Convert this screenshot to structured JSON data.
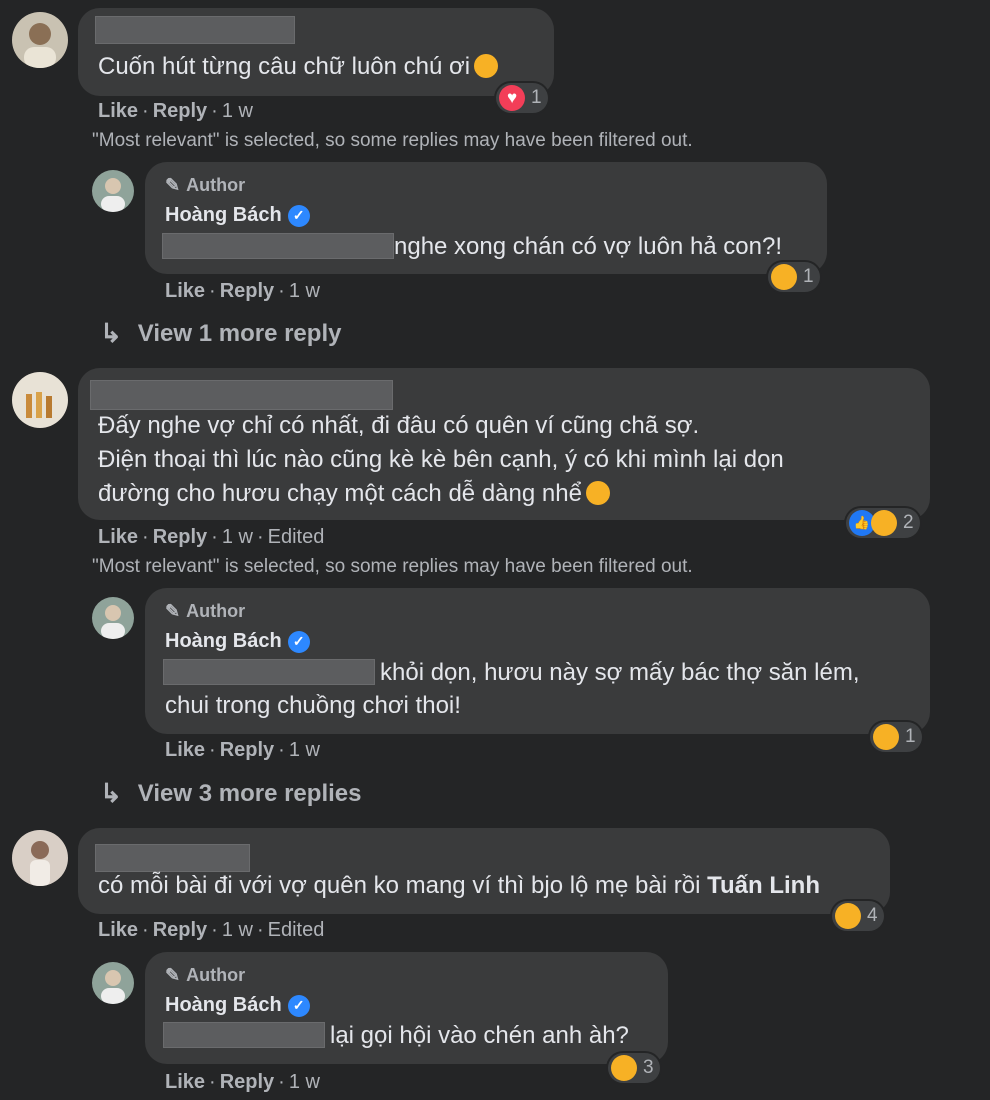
{
  "thread": {
    "comment1": {
      "text": "Cuốn hút từng câu chữ luôn chú ơi",
      "reaction_count": "1",
      "actions": {
        "like": "Like",
        "reply": "Reply",
        "time": "1 w"
      },
      "filter_note": "\"Most relevant\" is selected, so some replies may have been filtered out.",
      "reply": {
        "author_tag": "Author",
        "author_name": "Hoàng Bách",
        "text": "nghe xong chán có vợ luôn hả con?!",
        "reaction_count": "1",
        "actions": {
          "like": "Like",
          "reply": "Reply",
          "time": "1 w"
        }
      },
      "view_more": "View 1 more reply"
    },
    "comment2": {
      "line1": "Đấy nghe vợ chỉ có nhất, đi đâu có quên ví cũng chã sợ.",
      "line2": "Điện thoại thì lúc nào cũng kè kè bên cạnh, ý có khi mình lại dọn",
      "line3": "đường cho hươu chạy một cách dễ dàng nhể",
      "reaction_count": "2",
      "actions": {
        "like": "Like",
        "reply": "Reply",
        "time": "1 w",
        "edited": "Edited"
      },
      "filter_note": "\"Most relevant\" is selected, so some replies may have been filtered out.",
      "reply": {
        "author_tag": "Author",
        "author_name": "Hoàng Bách",
        "line1": "khỏi dọn, hươu này sợ mấy bác thợ săn lém,",
        "line2": "chui trong chuồng chơi thoi!",
        "reaction_count": "1",
        "actions": {
          "like": "Like",
          "reply": "Reply",
          "time": "1 w"
        }
      },
      "view_more": "View 3 more replies"
    },
    "comment3": {
      "text": "có mỗi bài đi với vợ quên ko mang ví thì bjo lộ mẹ bài rồi",
      "mention": "Tuấn Linh",
      "reaction_count": "4",
      "actions": {
        "like": "Like",
        "reply": "Reply",
        "time": "1 w",
        "edited": "Edited"
      },
      "reply": {
        "author_tag": "Author",
        "author_name": "Hoàng Bách",
        "text": "lại gọi hội vào chén anh àh?",
        "reaction_count": "3",
        "actions": {
          "like": "Like",
          "reply": "Reply",
          "time": "1 w"
        }
      }
    }
  },
  "icons": {
    "reply_arrow": "↳",
    "pencil": "✎",
    "verified": "✓",
    "heart": "♥",
    "like": "👍"
  },
  "colors": {
    "background": "#242526",
    "bubble": "#3a3b3c",
    "text": "#e4e6eb",
    "muted": "#b0b3b8",
    "verified": "#2d88ff",
    "heart": "#f33e58",
    "haha": "#f7b125"
  }
}
